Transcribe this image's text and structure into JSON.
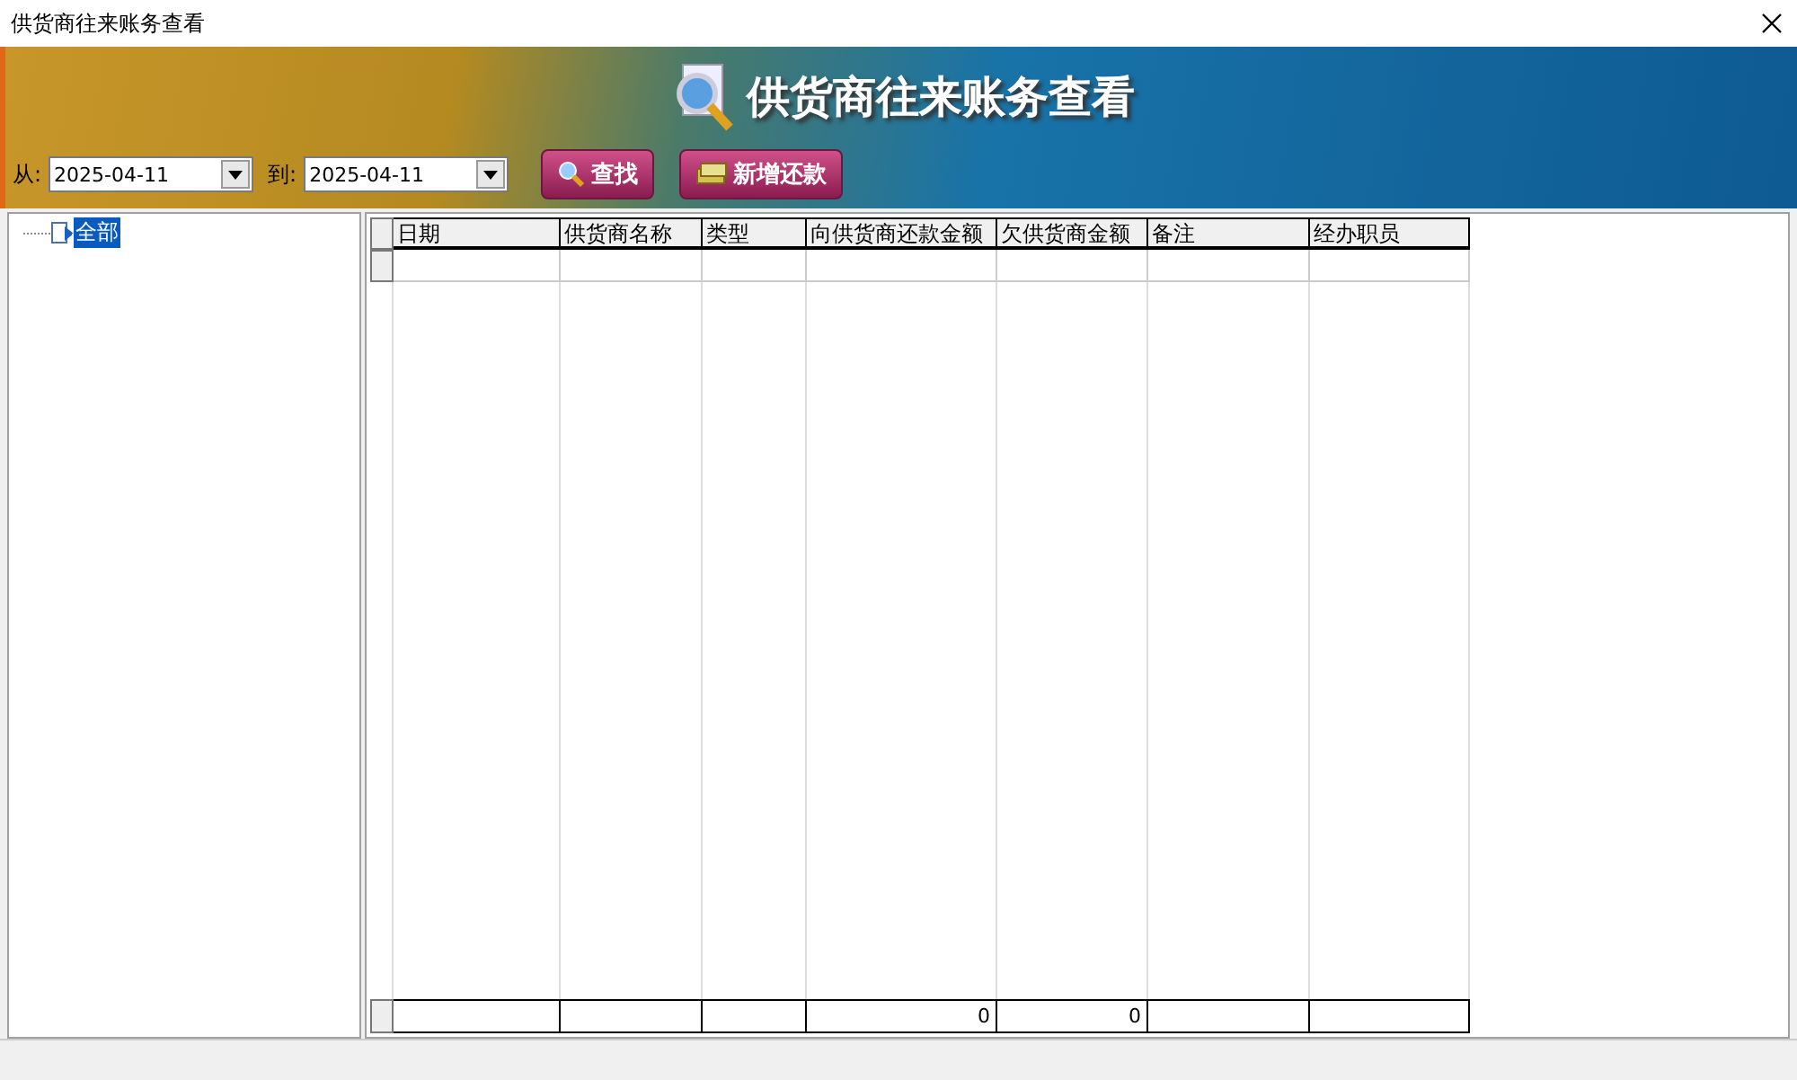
{
  "window": {
    "title": "供货商往来账务查看"
  },
  "banner": {
    "title": "供货商往来账务查看"
  },
  "filter": {
    "from_label": "从:",
    "from_value": "2025-04-11",
    "to_label": "到:",
    "to_value": "2025-04-11"
  },
  "buttons": [
    {
      "kind": "search",
      "label": "查找"
    },
    {
      "kind": "money",
      "label": "新增还款"
    }
  ],
  "tree": {
    "items": [
      {
        "label": "全部",
        "selected": true
      }
    ]
  },
  "table": {
    "columns": [
      {
        "label": "日期"
      },
      {
        "label": "供货商名称"
      },
      {
        "label": "类型"
      },
      {
        "label": "向供货商还款金额",
        "total": "0"
      },
      {
        "label": "欠供货商金额",
        "total": "0"
      },
      {
        "label": "备注"
      },
      {
        "label": "经办职员"
      }
    ]
  }
}
